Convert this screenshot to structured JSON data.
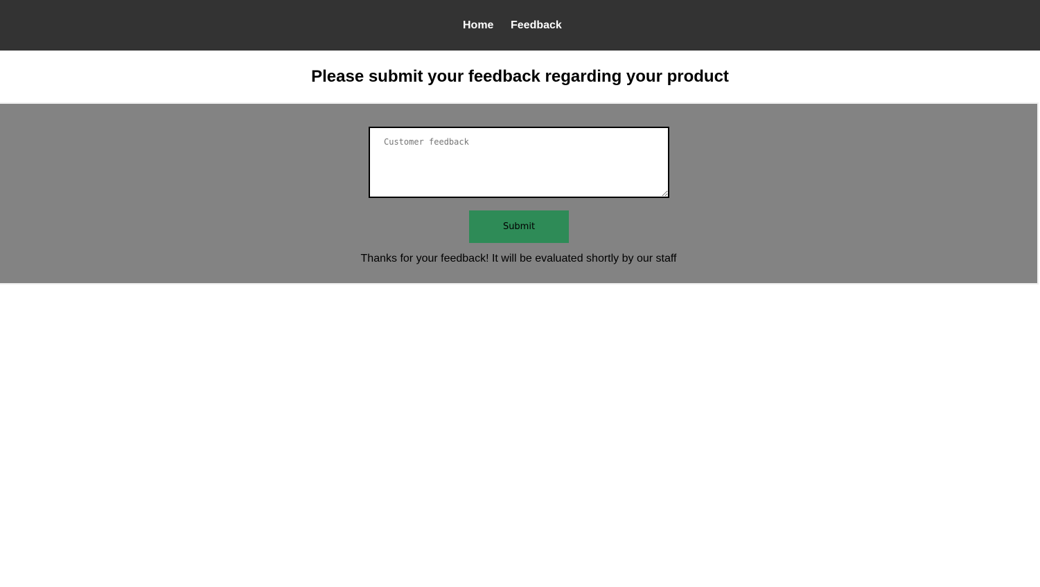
{
  "nav": {
    "items": [
      {
        "label": "Home"
      },
      {
        "label": "Feedback"
      }
    ]
  },
  "page": {
    "title": "Please submit your feedback regarding your product"
  },
  "form": {
    "feedback_placeholder": "Customer feedback",
    "feedback_value": "",
    "submit_label": "Submit",
    "thanks_message": "Thanks for your feedback! It will be evaluated shortly by our staff"
  },
  "colors": {
    "nav_background": "#333333",
    "panel_background": "#838383",
    "submit_button": "#2e8b57"
  }
}
